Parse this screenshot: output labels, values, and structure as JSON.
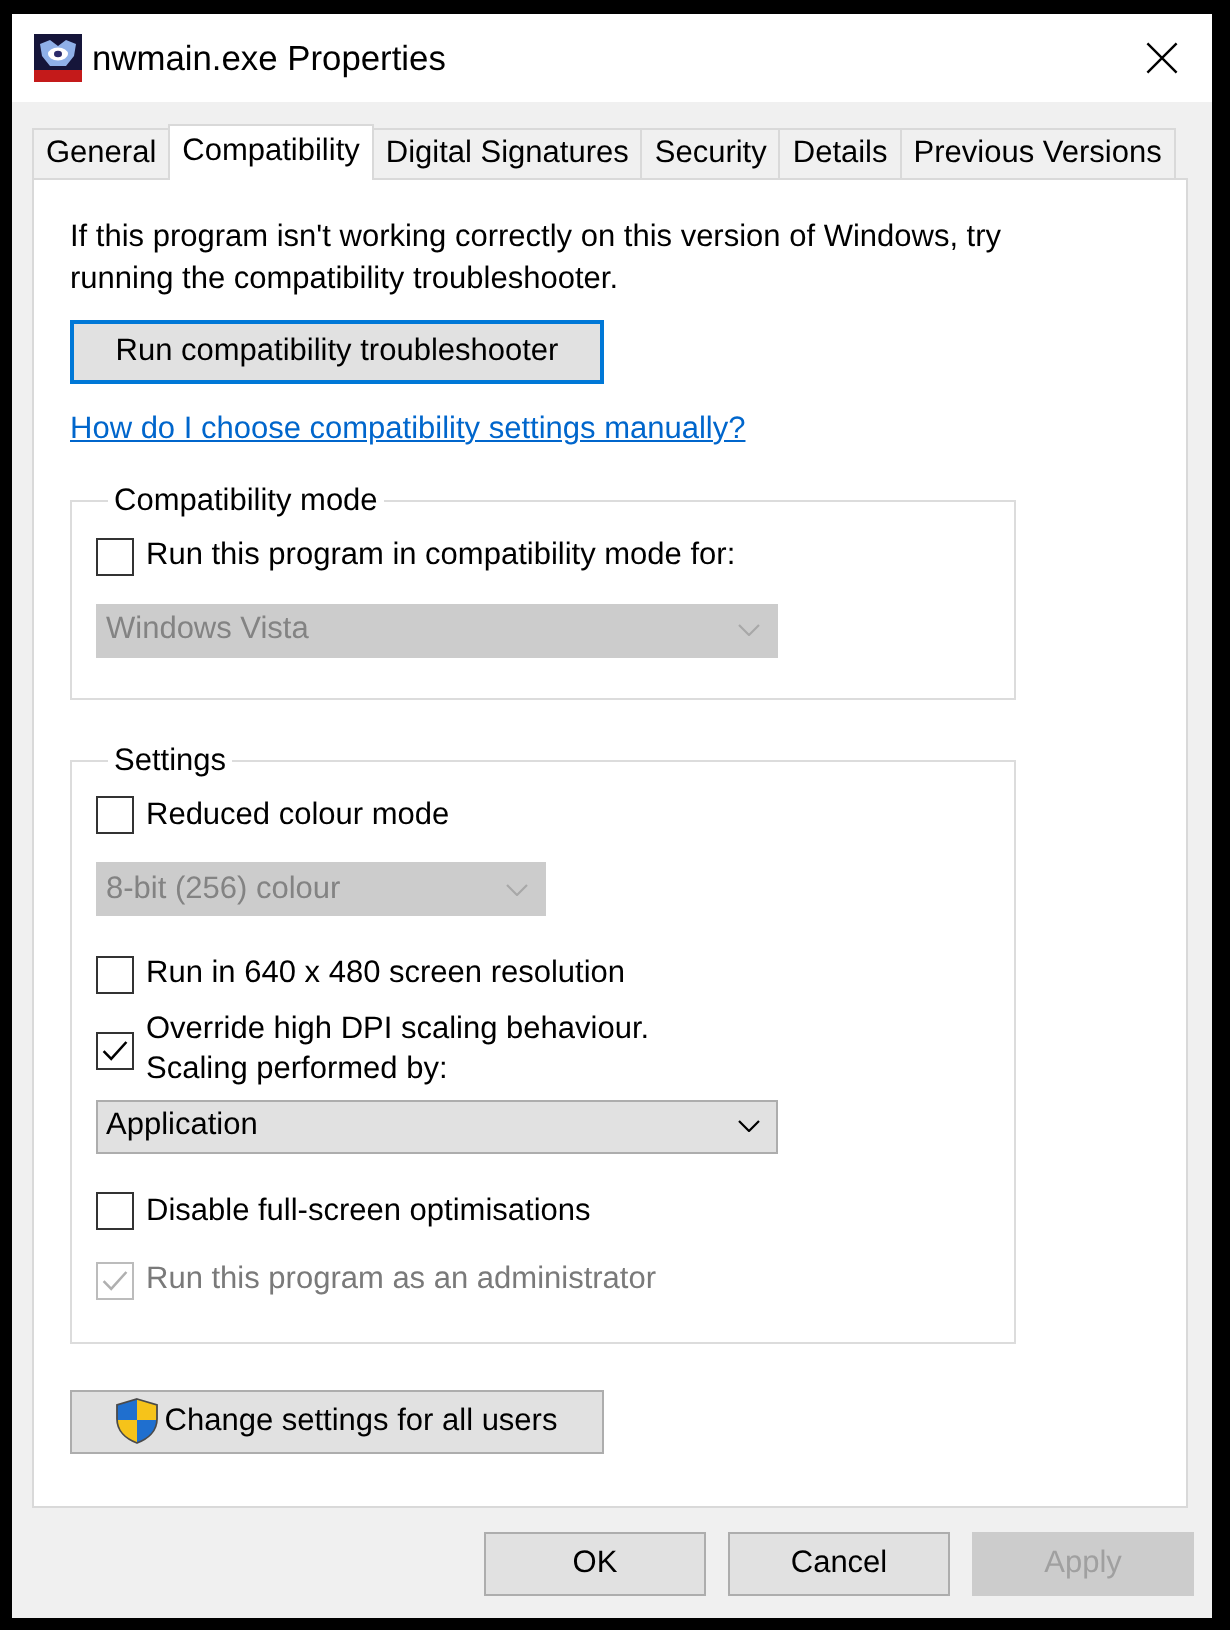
{
  "window": {
    "title": "nwmain.exe Properties"
  },
  "tabs": [
    {
      "label": "General",
      "selected": false
    },
    {
      "label": "Compatibility",
      "selected": true
    },
    {
      "label": "Digital Signatures",
      "selected": false
    },
    {
      "label": "Security",
      "selected": false
    },
    {
      "label": "Details",
      "selected": false
    },
    {
      "label": "Previous Versions",
      "selected": false
    }
  ],
  "intro": "If this program isn't working correctly on this version of Windows, try running the compatibility troubleshooter.",
  "troubleshooter_button": {
    "label": "Run compatibility troubleshooter",
    "focused": true
  },
  "help_link": "How do I choose compatibility settings manually?",
  "groups": [
    {
      "title": "Compatibility mode",
      "items": [
        {
          "kind": "checkbox",
          "label": "Run this program in compatibility mode for:",
          "checked": false,
          "disabled": false
        },
        {
          "kind": "dropdown",
          "value": "Windows Vista",
          "disabled": true
        }
      ]
    },
    {
      "title": "Settings",
      "items": [
        {
          "kind": "checkbox",
          "label": "Reduced colour mode",
          "checked": false,
          "disabled": false
        },
        {
          "kind": "dropdown",
          "value": "8-bit (256) colour",
          "disabled": true
        },
        {
          "kind": "checkbox",
          "label": "Run in 640 x 480 screen resolution",
          "checked": false,
          "disabled": false
        },
        {
          "kind": "checkbox",
          "label": "Override high DPI scaling behaviour.\nScaling performed by:",
          "checked": true,
          "disabled": false
        },
        {
          "kind": "dropdown",
          "value": "Application",
          "disabled": false
        },
        {
          "kind": "checkbox",
          "label": "Disable full-screen optimisations",
          "checked": false,
          "disabled": false
        },
        {
          "kind": "checkbox",
          "label": "Run this program as an administrator",
          "checked": true,
          "disabled": true
        }
      ]
    }
  ],
  "all_users_button": {
    "label": "Change settings for all users"
  },
  "buttons": [
    {
      "label": "OK",
      "disabled": false
    },
    {
      "label": "Cancel",
      "disabled": false
    },
    {
      "label": "Apply",
      "disabled": true
    }
  ]
}
